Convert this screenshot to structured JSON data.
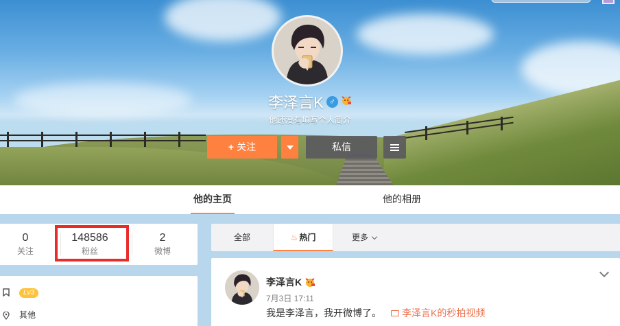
{
  "profile": {
    "name": "李泽言K",
    "gender_symbol": "♂",
    "bio": "他还没有填写个人简介",
    "follow_label": "关注",
    "follow_plus": "+",
    "message_label": "私信"
  },
  "tabs": {
    "home": "他的主页",
    "album": "他的相册"
  },
  "stats": {
    "following": {
      "value": "0",
      "label": "关注"
    },
    "fans": {
      "value": "148586",
      "label": "粉丝"
    },
    "posts": {
      "value": "2",
      "label": "微博"
    }
  },
  "info": {
    "level": "Lv3",
    "location": "其他"
  },
  "feed_filter": {
    "all": "全部",
    "hot": "热门",
    "more": "更多"
  },
  "post": {
    "author": "李泽言K",
    "time": "7月3日 17:11",
    "text": "我是李泽言，我开微博了。",
    "link": "李泽言K的秒拍视频"
  },
  "colors": {
    "accent": "#ff8140",
    "highlight_box": "#e82b2b",
    "link": "#eb7350"
  },
  "icons": [
    "gender-male-icon",
    "vip-emoji-icon",
    "caret-down-icon",
    "menu-icon",
    "flame-icon",
    "chevron-down-icon",
    "bookmark-icon",
    "location-icon",
    "video-icon"
  ]
}
